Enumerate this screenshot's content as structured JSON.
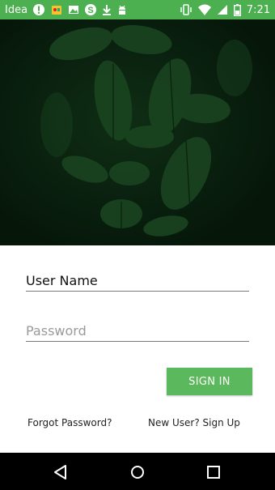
{
  "status_bar": {
    "carrier": "Idea",
    "time": "7:21",
    "icons": [
      "alert-icon",
      "game-icon",
      "gallery-icon",
      "skype-icon",
      "download-icon",
      "android-icon",
      "vibrate-icon",
      "wifi-icon",
      "signal-icon",
      "battery-icon"
    ],
    "color": "#4caf50"
  },
  "hero": {
    "image": "dark-green-leaves"
  },
  "login": {
    "username_value": "User Name",
    "password_placeholder": "Password",
    "sign_in_label": "SIGN IN",
    "forgot_password_label": "Forgot Password?",
    "sign_up_label": "New User? Sign Up",
    "accent_color": "#5cb85c"
  },
  "nav_bar": {
    "icons": [
      "back-icon",
      "home-icon",
      "recents-icon"
    ]
  }
}
